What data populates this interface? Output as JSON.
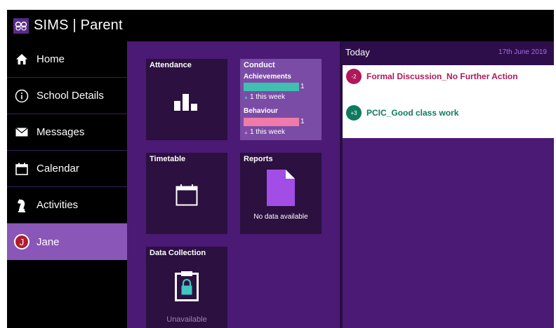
{
  "app": {
    "title": "SIMS | Parent",
    "logo_icon": "sims-logo-icon"
  },
  "sidebar": {
    "items": [
      {
        "label": "Home",
        "icon": "home-icon"
      },
      {
        "label": "School Details",
        "icon": "info-icon"
      },
      {
        "label": "Messages",
        "icon": "envelope-icon"
      },
      {
        "label": "Calendar",
        "icon": "calendar-icon"
      },
      {
        "label": "Activities",
        "icon": "chess-knight-icon"
      },
      {
        "label": "Jane",
        "icon": "avatar",
        "initial": "J",
        "active": true
      }
    ]
  },
  "tiles": {
    "attendance": {
      "title": "Attendance",
      "icon": "bar-chart-icon"
    },
    "conduct": {
      "title": "Conduct",
      "achievements": {
        "label": "Achievements",
        "count": "1",
        "week": "1 this week",
        "color": "#3fc0b0"
      },
      "behaviour": {
        "label": "Behaviour",
        "count": "1",
        "week": "1 this week",
        "color": "#f07aaa"
      }
    },
    "timetable": {
      "title": "Timetable",
      "icon": "calendar-icon"
    },
    "reports": {
      "title": "Reports",
      "icon": "document-icon",
      "status": "No data available"
    },
    "data_collection": {
      "title": "Data Collection",
      "icon": "clipboard-lock-icon",
      "status": "Unavailable"
    }
  },
  "today": {
    "label": "Today",
    "date": "17th June 2019",
    "events": [
      {
        "points": "-2",
        "text": "Formal Discussion_No Further Action",
        "color": "#b0185a"
      },
      {
        "points": "+3",
        "text": "PCIC_Good class work",
        "color": "#0f7a5e"
      }
    ]
  },
  "colors": {
    "accent": "#4a1a74",
    "active_nav": "#8a56b8",
    "tile": "#2b1040"
  }
}
